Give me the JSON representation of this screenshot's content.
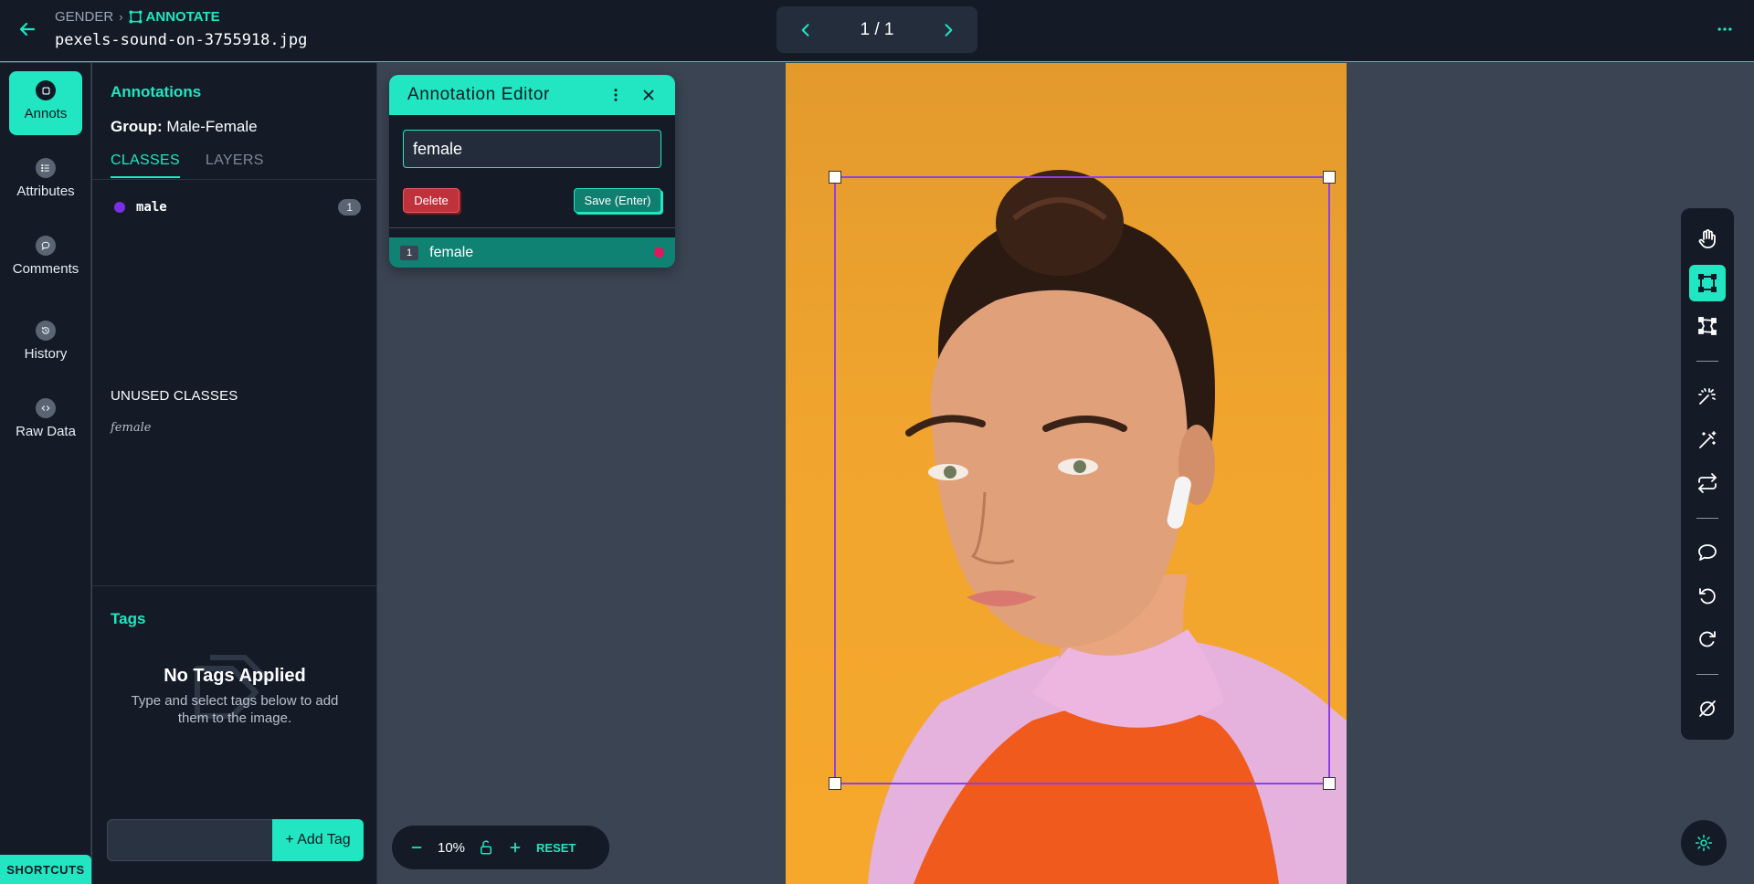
{
  "header": {
    "breadcrumb_project": "GENDER",
    "breadcrumb_page": "ANNOTATE",
    "filename": "pexels-sound-on-3755918.jpg",
    "pager": "1 / 1"
  },
  "rail": {
    "items": [
      {
        "label": "Annots",
        "icon": "annotation-icon",
        "active": true
      },
      {
        "label": "Attributes",
        "icon": "list-icon"
      },
      {
        "label": "Comments",
        "icon": "comment-icon"
      },
      {
        "label": "History",
        "icon": "history-icon"
      },
      {
        "label": "Raw Data",
        "icon": "code-icon"
      }
    ],
    "shortcuts_label": "SHORTCUTS"
  },
  "panel": {
    "title": "Annotations",
    "group_label": "Group:",
    "group_value": "Male-Female",
    "tabs": [
      {
        "label": "CLASSES",
        "active": true
      },
      {
        "label": "LAYERS"
      }
    ],
    "classes": [
      {
        "name": "male",
        "count": "1",
        "color": "#7b2ee6"
      }
    ],
    "unused_title": "UNUSED CLASSES",
    "unused": [
      "female"
    ],
    "tags_title": "Tags",
    "no_tags_title": "No Tags Applied",
    "no_tags_sub": "Type and select tags below to add them to the image.",
    "tag_input_value": "",
    "add_tag_label": "+ Add Tag"
  },
  "editor": {
    "title": "Annotation Editor",
    "input_value": "female",
    "delete_label": "Delete",
    "save_label": "Save (Enter)",
    "rows": [
      {
        "num": "1",
        "name": "female",
        "color": "#e0185a"
      }
    ]
  },
  "zoom": {
    "level": "10%",
    "reset_label": "RESET"
  },
  "toolbar": {
    "tools": [
      "hand-icon",
      "bounding-box-icon",
      "polygon-icon",
      "magic-select-icon",
      "magic-wand-icon",
      "repeat-icon",
      "comment-icon",
      "undo-icon",
      "redo-icon",
      "hide-icon"
    ],
    "active_tool": "bounding-box-icon"
  },
  "colors": {
    "accent": "#21e6c1",
    "bbox": "#8f3fe8",
    "background": "#141b27"
  }
}
